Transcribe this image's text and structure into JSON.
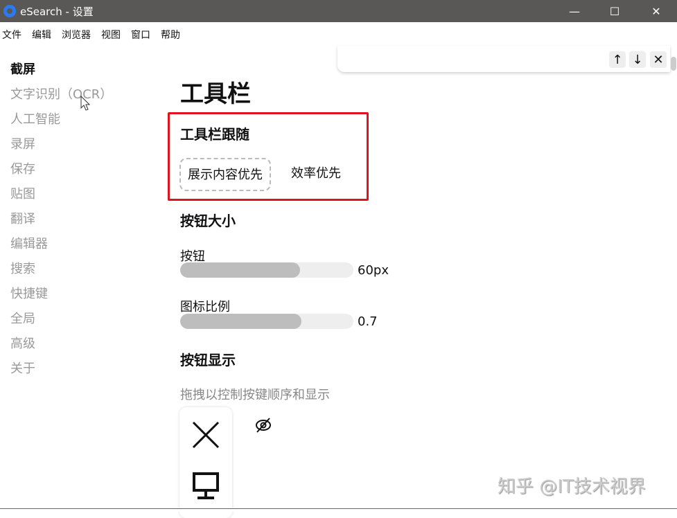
{
  "window": {
    "title": "eSearch - 设置"
  },
  "menu": [
    "文件",
    "编辑",
    "浏览器",
    "视图",
    "窗口",
    "帮助"
  ],
  "sidebar": {
    "items": [
      "截屏",
      "文字识别（OCR）",
      "人工智能",
      "录屏",
      "保存",
      "贴图",
      "翻译",
      "编辑器",
      "搜索",
      "快捷键",
      "全局",
      "高级",
      "关于"
    ],
    "active": 0
  },
  "main": {
    "title": "工具栏",
    "follow": {
      "heading": "工具栏跟随",
      "options": [
        "展示内容优先",
        "效率优先"
      ],
      "selected": 0
    },
    "size": {
      "heading": "按钮大小",
      "button": {
        "label": "按钮",
        "value": "60px",
        "fraction": 0.69
      },
      "icon_ratio": {
        "label": "图标比例",
        "value": "0.7",
        "fraction": 0.7
      }
    },
    "display": {
      "heading": "按钮显示",
      "hint": "拖拽以控制按键顺序和显示"
    }
  },
  "watermark": "知乎 @IT技术视界"
}
